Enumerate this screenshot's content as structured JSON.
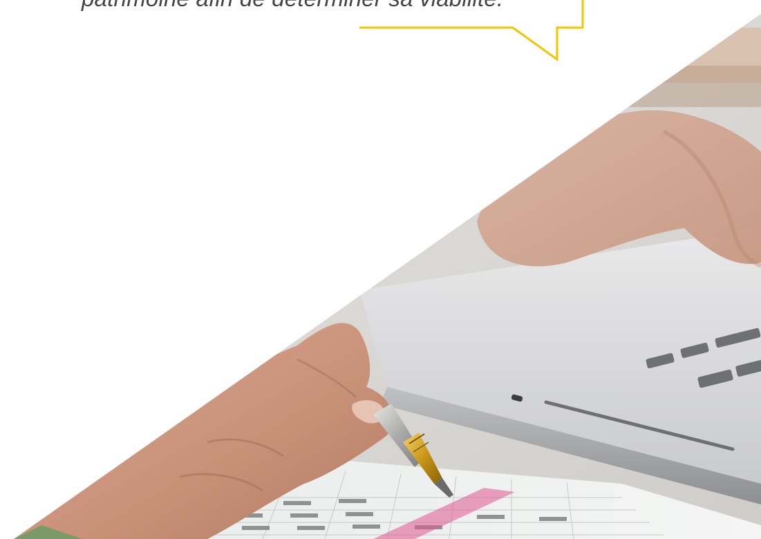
{
  "quote": {
    "text": "patrimoine afin de déterminer sa viabilité."
  },
  "colors": {
    "bubble_outline": "#f2c500",
    "text": "#444444",
    "highlight_row": "#e0558f"
  },
  "photo": {
    "subject": "hands-reviewing-spreadsheet-with-pen-near-laptop"
  }
}
